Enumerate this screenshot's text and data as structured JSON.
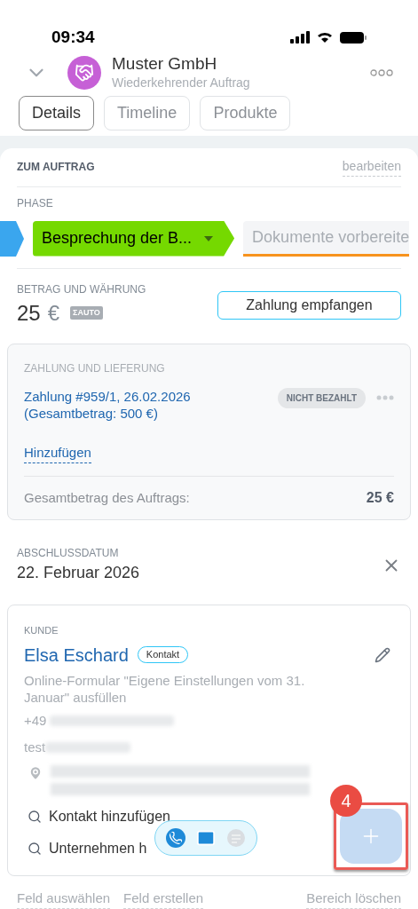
{
  "status_bar": {
    "time": "09:34"
  },
  "header": {
    "title": "Muster GmbH",
    "subtitle": "Wiederkehrender Auftrag"
  },
  "tabs": [
    {
      "label": "Details",
      "selected": true
    },
    {
      "label": "Timeline",
      "selected": false
    },
    {
      "label": "Produkte",
      "selected": false
    }
  ],
  "section": {
    "title": "ZUM AUFTRAG",
    "edit_link": "bearbeiten"
  },
  "phase": {
    "label": "PHASE",
    "stages": [
      {
        "label": "Besprechung der B...",
        "selected": true,
        "color": "#75d900"
      },
      {
        "label": "Dokumente vorbereite",
        "selected": false,
        "color": "#f7931e"
      }
    ]
  },
  "amount": {
    "label": "BETRAG UND WÄHRUNG",
    "value": "25",
    "currency": "€",
    "badge": "ΣAUTO",
    "button": "Zahlung empfangen"
  },
  "payment": {
    "title": "ZAHLUNG UND LIEFERUNG",
    "entry": "Zahlung #959/1, 26.02.2026\n(Gesamtbetrag: 500 €)",
    "status": "NICHT BEZAHLT",
    "add_link": "Hinzufügen",
    "total_label": "Gesamtbetrag des Auftrags:",
    "total_value": "25 €"
  },
  "close_date": {
    "label": "ABSCHLUSSDATUM",
    "value": "22. Februar 2026"
  },
  "customer": {
    "label": "KUNDE",
    "name": "Elsa Eschard",
    "tag": "Kontakt",
    "source": "Online-Formular \"Eigene Einstellungen vom 31. Januar\" ausfüllen",
    "phone": "+49",
    "email": "test",
    "actions": [
      "Kontakt hinzufügen",
      "Unternehmen h"
    ]
  },
  "annotation": {
    "number": "4"
  },
  "footer_links": [
    "Feld auswählen",
    "Feld erstellen",
    "Bereich löschen"
  ]
}
